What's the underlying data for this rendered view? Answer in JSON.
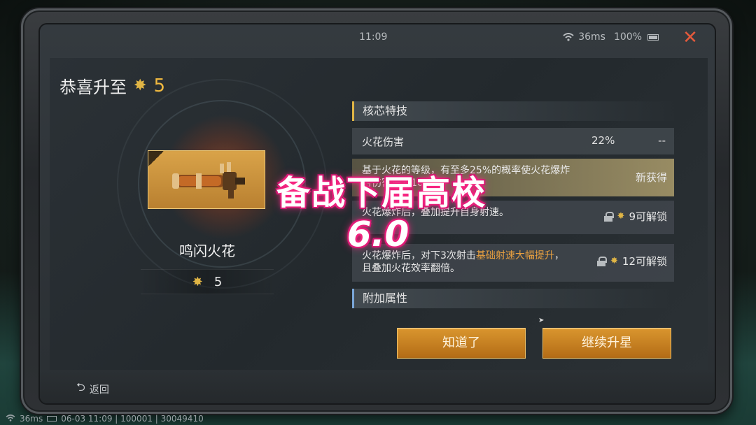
{
  "status_bar": {
    "time": "11:09",
    "ping": "36ms",
    "battery": "100%"
  },
  "congrats": {
    "label": "恭喜升至",
    "level": "5"
  },
  "weapon": {
    "name": "鸣闪火花",
    "stars": "5"
  },
  "sections": {
    "core_skill": "核芯特技",
    "extra_attr": "附加属性"
  },
  "skills": {
    "row_name": "火花伤害",
    "row_pct": "22%",
    "row_dash": "--",
    "desc1": "基于火花的等级，有至多25%的概率使火花爆炸时伤害提升100%",
    "desc1_state": "新获得",
    "desc2": "火花爆炸后，叠加提升自身射速。",
    "desc2_unlock": "9可解锁",
    "desc3_pre": "火花爆炸后，对下3次射击",
    "desc3_orange": "基础射速大幅提升",
    "desc3_post": "，且叠加火花效率翻倍。",
    "desc3_unlock": "12可解锁"
  },
  "buttons": {
    "ok": "知道了",
    "continue": "继续升星",
    "back": "返回"
  },
  "overlay": {
    "title": "备战下届高校",
    "version": "6.0"
  },
  "footer": {
    "ping": "36ms",
    "info": "06-03 11:09 | 100001 | 30049410"
  },
  "colors": {
    "accent_gold": "#e0b545",
    "button_orange": "#d9952e",
    "neon_pink": "#ff2a86"
  }
}
